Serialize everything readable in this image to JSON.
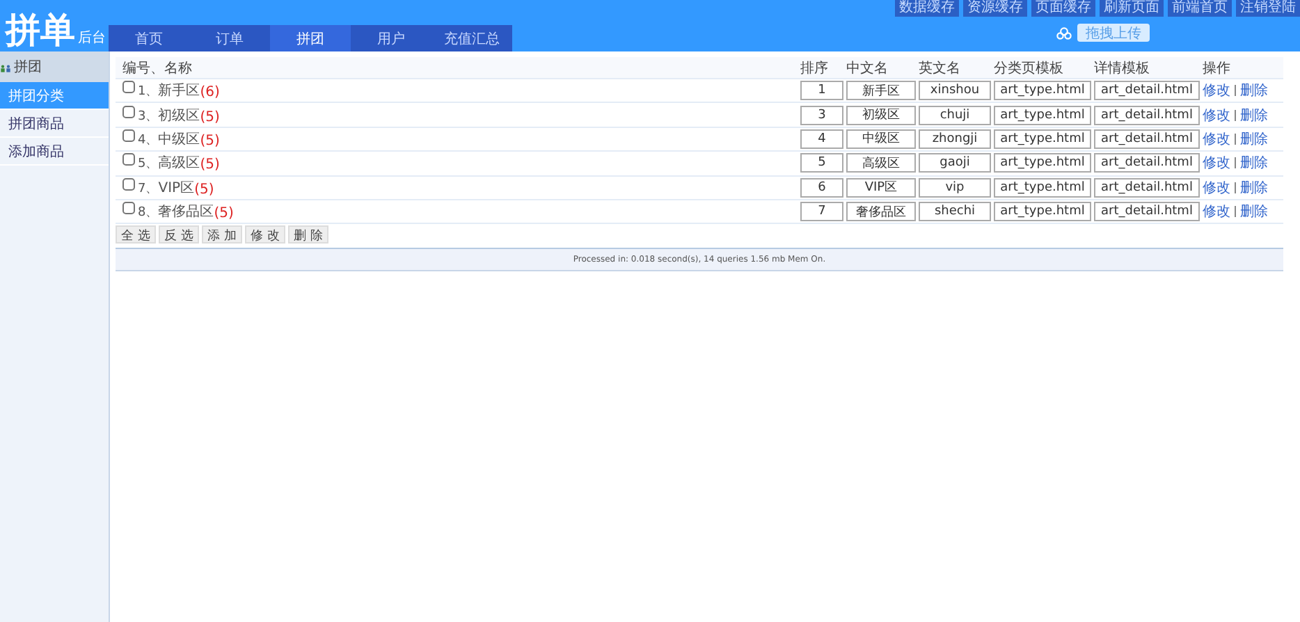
{
  "logo": {
    "title": "拼单",
    "subtitle": "后台"
  },
  "nav": [
    {
      "label": "首页",
      "selected": false
    },
    {
      "label": "订单",
      "selected": false
    },
    {
      "label": "拼团",
      "selected": true
    },
    {
      "label": "用户",
      "selected": false
    },
    {
      "label": "充值汇总",
      "selected": false
    }
  ],
  "top_buttons": [
    "数据缓存",
    "资源缓存",
    "页面缓存",
    "刷新页面",
    "前端首页",
    "注销登陆"
  ],
  "upload_button": "拖拽上传",
  "sidebar": {
    "title": "拼团",
    "items": [
      {
        "label": "拼团分类",
        "selected": true
      },
      {
        "label": "拼团商品",
        "selected": false
      },
      {
        "label": "添加商品",
        "selected": false
      }
    ]
  },
  "table": {
    "columns": [
      "编号、名称",
      "排序",
      "中文名",
      "英文名",
      "分类页模板",
      "详情模板",
      "操作"
    ],
    "rows": [
      {
        "checked": false,
        "number": "1、",
        "name": "新手区",
        "count": "(6)",
        "sort": "1",
        "cn_name": "新手区",
        "en_name": "xinshou",
        "list_template": "art_type.html",
        "detail_template": "art_detail.html",
        "edit": "修改",
        "delete": "删除"
      },
      {
        "checked": false,
        "number": "3、",
        "name": "初级区",
        "count": "(5)",
        "sort": "3",
        "cn_name": "初级区",
        "en_name": "chuji",
        "list_template": "art_type.html",
        "detail_template": "art_detail.html",
        "edit": "修改",
        "delete": "删除"
      },
      {
        "checked": false,
        "number": "4、",
        "name": "中级区",
        "count": "(5)",
        "sort": "4",
        "cn_name": "中级区",
        "en_name": "zhongji",
        "list_template": "art_type.html",
        "detail_template": "art_detail.html",
        "edit": "修改",
        "delete": "删除"
      },
      {
        "checked": false,
        "number": "5、",
        "name": "高级区",
        "count": "(5)",
        "sort": "5",
        "cn_name": "高级区",
        "en_name": "gaoji",
        "list_template": "art_type.html",
        "detail_template": "art_detail.html",
        "edit": "修改",
        "delete": "删除"
      },
      {
        "checked": false,
        "number": "7、",
        "name": "VIP区",
        "count": "(5)",
        "sort": "6",
        "cn_name": "VIP区",
        "en_name": "vip",
        "list_template": "art_type.html",
        "detail_template": "art_detail.html",
        "edit": "修改",
        "delete": "删除"
      },
      {
        "checked": false,
        "number": "8、",
        "name": "奢侈品区",
        "count": "(5)",
        "sort": "7",
        "cn_name": "奢侈品区",
        "en_name": "shechi",
        "list_template": "art_type.html",
        "detail_template": "art_detail.html",
        "edit": "修改",
        "delete": "删除"
      }
    ]
  },
  "action_buttons": [
    "全 选",
    "反 选",
    "添 加",
    "修 改",
    "删 除"
  ],
  "footer": "Processed in: 0.018 second(s), 14 queries 1.56 mb Mem On."
}
